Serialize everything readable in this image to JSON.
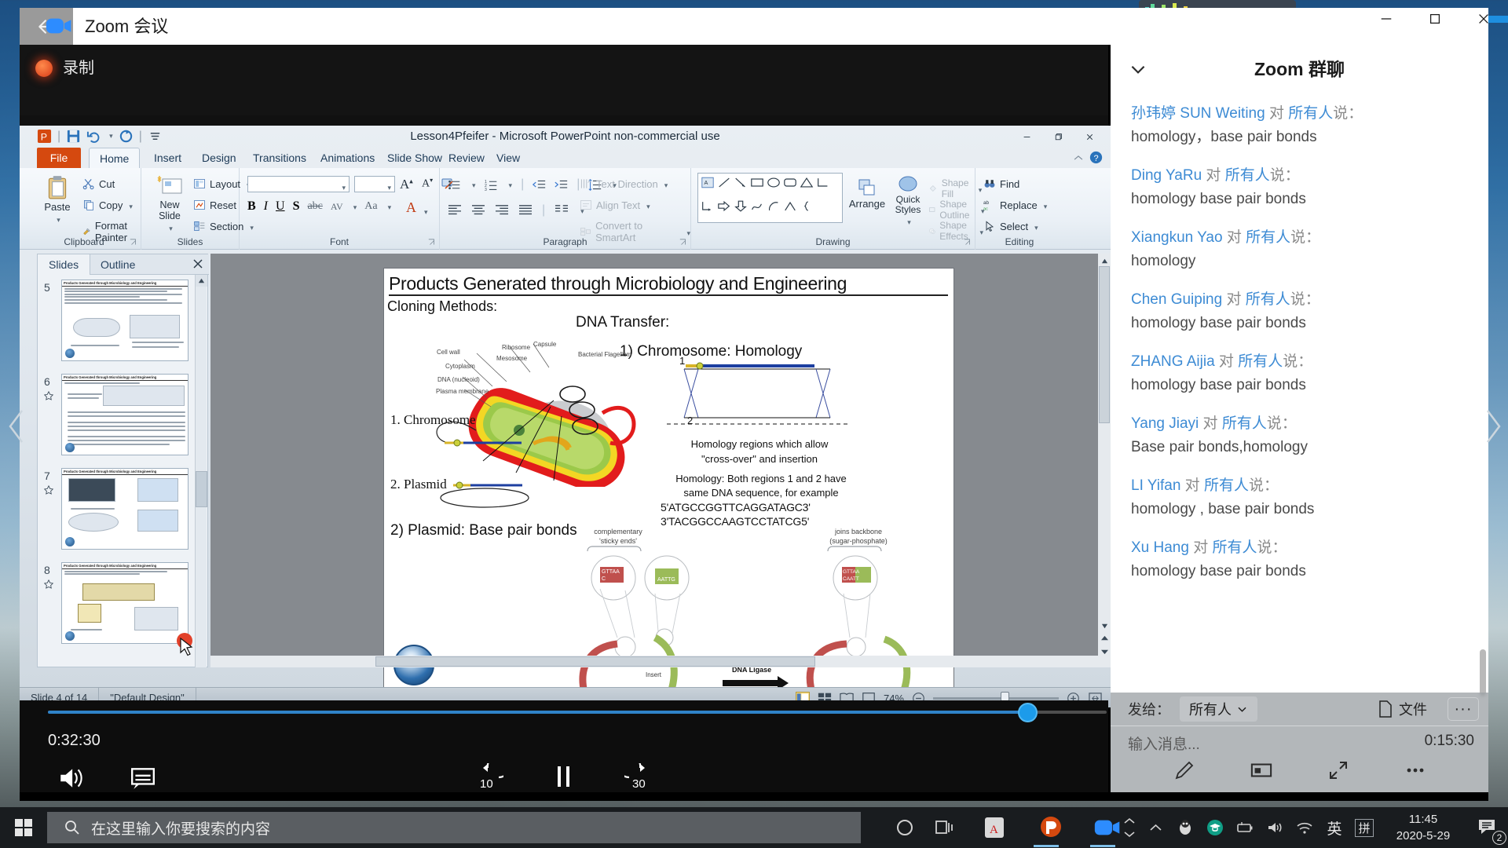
{
  "zoom_window": {
    "title": "Zoom 会议",
    "back_icon": "back-arrow-icon",
    "app_icon": "zoom-camera-icon",
    "minimize": "−",
    "maximize": "□",
    "close": "✕",
    "recording_label": "录制"
  },
  "powerpoint": {
    "title": "Lesson4Pfeifer  -  Microsoft PowerPoint non-commercial use",
    "quick_access": [
      "powerpoint-logo",
      "save-icon",
      "undo-icon",
      "redo-icon",
      "customize-qat-icon"
    ],
    "tabs": [
      "File",
      "Home",
      "Insert",
      "Design",
      "Transitions",
      "Animations",
      "Slide Show",
      "Review",
      "View"
    ],
    "active_tab": "Home",
    "ribbon_groups": [
      {
        "label": "Clipboard",
        "items": [
          "Paste",
          "Cut",
          "Copy",
          "Format Painter"
        ]
      },
      {
        "label": "Slides",
        "items": [
          "New Slide",
          "Layout",
          "Reset",
          "Section"
        ]
      },
      {
        "label": "Font",
        "items": [
          "B",
          "I",
          "U",
          "S",
          "abc",
          "AV",
          "Aa",
          "A"
        ]
      },
      {
        "label": "Paragraph",
        "items": [
          "Text Direction",
          "Align Text",
          "Convert to SmartArt"
        ]
      },
      {
        "label": "Drawing",
        "items": [
          "Arrange",
          "Quick Styles",
          "Shape Fill",
          "Shape Outline",
          "Shape Effects"
        ]
      },
      {
        "label": "Editing",
        "items": [
          "Find",
          "Replace",
          "Select"
        ]
      }
    ],
    "slides_panel": {
      "tabs": [
        "Slides",
        "Outline"
      ],
      "active_tab": "Slides",
      "close_icon": "close-icon",
      "thumbnails": [
        {
          "number": "5",
          "title": "Products Generated through Microbiology  and Engineering"
        },
        {
          "number": "6",
          "title": "Products Generated through Microbiology  and Engineering"
        },
        {
          "number": "7",
          "title": "Products Generated through Microbiology  and Engineering"
        },
        {
          "number": "8",
          "title": "Products Generated through Microbiology  and Engineering"
        }
      ]
    },
    "status": {
      "slide_count": "Slide 4 of 14",
      "theme": "\"Default Design\"",
      "zoom_percent": "74%",
      "view_icons": [
        "normal-view-icon",
        "slide-sorter-icon",
        "reading-view-icon",
        "slide-show-icon"
      ],
      "zoom_out": "−",
      "zoom_in": "+",
      "fit_icon": "fit-slide-to-window-icon"
    },
    "slide": {
      "title": "Products Generated through Microbiology and Engineering",
      "cloning_methods": "Cloning  Methods:",
      "dna_transfer": "DNA Transfer:",
      "item1": "1)   Chromosome: Homology",
      "label_chromosome": "1. Chromosome",
      "label_plasmid": "2. Plasmid",
      "item2": "2) Plasmid: Base pair bonds",
      "homology_line1": "Homology regions which allow",
      "homology_line2": "\"cross-over\" and insertion",
      "homology_line3": "Homology: Both regions 1 and 2 have",
      "homology_line4": "same DNA sequence, for example",
      "seq_top": "5'ATGCCGGTTCAGGATAGC3'",
      "seq_bottom": "3'TACGGCCAAGTCCTATCG5'",
      "region_1": "1",
      "region_2": "2",
      "sticky_ends_line1": "complementary",
      "sticky_ends_line2": "'sticky ends'",
      "backbone_line1": "joins backbone",
      "backbone_line2": "(sugar-phosphate)",
      "insert_label": "Insert",
      "ligase_label": "DNA Ligase",
      "plasmid_label": "Plasmid",
      "micro_labels": [
        "Cell wall",
        "Ribosome",
        "Cytoplasm",
        "Capsule",
        "Mesosome",
        "DNA (nucleoid)",
        "Plasma membrane",
        "Bacterial Flagellum"
      ],
      "sticky_codes": [
        "GTTAA",
        "AATTG"
      ]
    }
  },
  "chat": {
    "title": "Zoom 群聊",
    "collapse_icon": "chevron-down-icon",
    "messages": [
      {
        "sender": "孙玮婷 SUN Weiting",
        "to_prefix": "对",
        "to": "所有人",
        "suffix": "说：",
        "body": "homology，base pair bonds"
      },
      {
        "sender": "Ding YaRu",
        "to_prefix": "对",
        "to": "所有人",
        "suffix": "说：",
        "body": "homology   base pair bonds"
      },
      {
        "sender": "Xiangkun Yao",
        "to_prefix": "对",
        "to": "所有人",
        "suffix": "说：",
        "body": "homology"
      },
      {
        "sender": "Chen Guiping",
        "to_prefix": "对",
        "to": "所有人",
        "suffix": "说：",
        "body": "homology   base pair bonds"
      },
      {
        "sender": "ZHANG Aijia",
        "to_prefix": "对",
        "to": "所有人",
        "suffix": "说：",
        "body": "homology   base pair bonds"
      },
      {
        "sender": "Yang Jiayi",
        "to_prefix": "对",
        "to": "所有人",
        "suffix": "说：",
        "body": "Base pair bonds,homology"
      },
      {
        "sender": "LI Yifan",
        "to_prefix": "对",
        "to": "所有人",
        "suffix": "说：",
        "body": "homology , base pair bonds"
      },
      {
        "sender": "Xu Hang",
        "to_prefix": "对",
        "to": "所有人",
        "suffix": "说：",
        "body": "homology base pair bonds"
      }
    ],
    "footer": {
      "send_to_label": "发给：",
      "send_to_value": "所有人",
      "file_label": "文件",
      "file_icon": "file-icon",
      "more_label": "···",
      "input_placeholder": "输入消息...",
      "remaining_time": "0:15:30",
      "tools": [
        "annotate-pencil-icon",
        "screenshot-icon",
        "exit-fullscreen-icon",
        "more-options-icon"
      ]
    }
  },
  "player": {
    "elapsed": "0:32:30",
    "progress_percent": 92,
    "controls": {
      "volume_icon": "volume-icon",
      "subtitles_icon": "subtitles-icon",
      "rewind_label": "10",
      "play_pause_icon": "pause-icon",
      "forward_label": "30"
    }
  },
  "taskbar": {
    "start_icon": "windows-start-icon",
    "search_placeholder": "在这里输入你要搜索的内容",
    "search_icon": "search-icon",
    "pinned": [
      "cortana-circle-icon",
      "task-view-icon",
      "adobe-acrobat-icon",
      "powerpoint-icon",
      "zoom-icon"
    ],
    "tray": [
      "show-hidden-icons-icon",
      "qq-penguin-icon",
      "education-app-icon",
      "battery-icon",
      "volume-icon",
      "wifi-icon"
    ],
    "ime_lang": "英",
    "ime_mode": "拼",
    "clock_time": "11:45",
    "clock_date": "2020-5-29",
    "notification_count": "2"
  },
  "colors": {
    "accent_blue": "#1e8fe0",
    "chat_name_blue": "#3d8bd4",
    "recording_red": "#d83a16",
    "ppt_orange": "#d5490f",
    "taskbar_dark": "#191c1f"
  }
}
